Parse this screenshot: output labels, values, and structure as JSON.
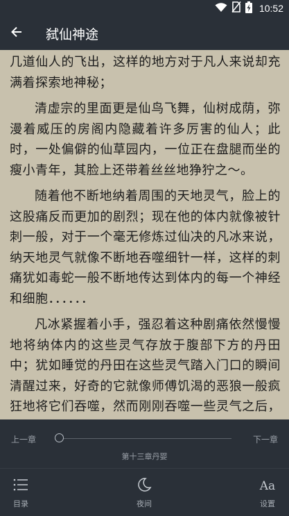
{
  "status_bar": {
    "time": "10:52",
    "icons": [
      "wifi-icon",
      "no-sim-icon",
      "battery-charging-icon"
    ]
  },
  "header": {
    "back_icon": "arrow-left-icon",
    "title": "弑仙神途"
  },
  "content": {
    "paragraphs": [
      "几道仙人的飞出，这样的地方对于凡人来说却充满着探索地神秘；",
      "清虚宗的里面更是仙鸟飞舞，仙树成荫，弥漫着威压的房阁内隐藏着许多厉害的仙人；此时，一处偏僻的仙草园内，一位正在盘腿而坐的瘦小青年，其脸上还带着丝丝地狰狞之～。",
      "随着他不断地纳着周围的天地灵气，脸上的这股痛反而更加的剧烈；现在他的体内就像被针刺一般，对于一个毫无修炼过仙决的凡冰来说，纳天地灵气就像不断地吞噬细针一样，这样的刺痛犹如毒蛇一般不断地传达到体内的每一个神经和细胞．．．．．．",
      "凡冰紧握着小手，强忍着这种剧痛依然慢慢地将纳体内的这些灵气存放于腹部下方的丹田中；犹如睡觉的丹田在这些灵气踏入门口的瞬间清醒过来，好奇的它就像师傅饥渴的恶狼一般疯狂地将它们吞噬，然而刚刚吞噬一些灵气之后，婴儿般的丹田才发现这些略微＊＊的气息并不是什么充饥的美食，而是一种能产生十分刺痛的毒药；"
    ]
  },
  "panel": {
    "prev_chapter": "上一章",
    "next_chapter": "下一章",
    "chapter_name": "第十三章丹婴",
    "progress": 0,
    "tools": [
      {
        "icon": "menu-list-icon",
        "label": "目录"
      },
      {
        "icon": "moon-icon",
        "label": "夜间"
      },
      {
        "icon": "font-settings-icon",
        "label": "设置"
      }
    ]
  },
  "colors": {
    "toolbar_bg": "#2a3038",
    "page_bg": "#c8c1ad",
    "text": "#1c1c1c"
  }
}
